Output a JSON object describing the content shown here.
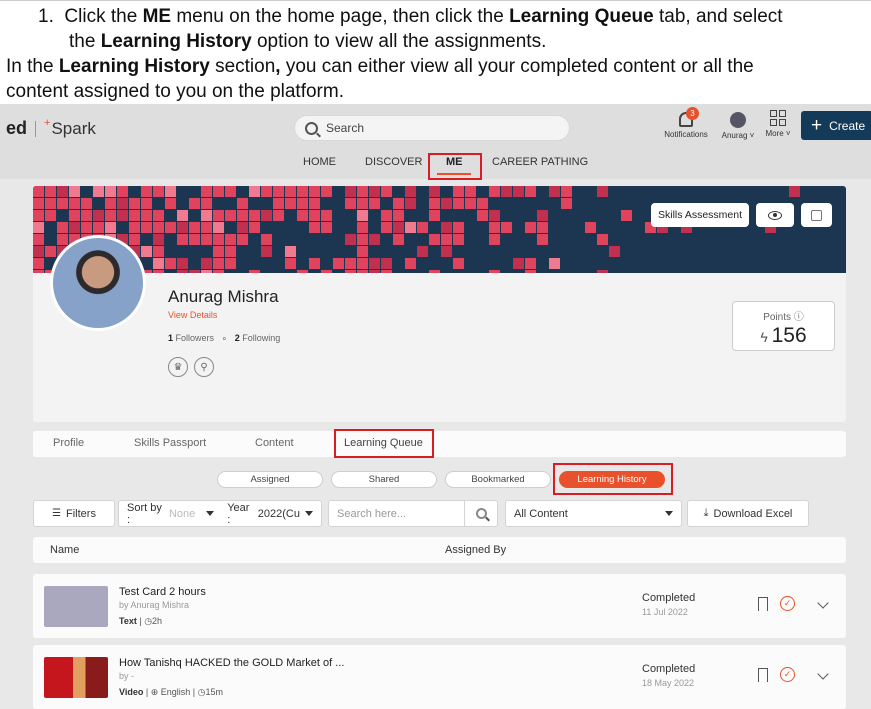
{
  "doc": {
    "line1_num": "1.",
    "line1_a": "Click the ",
    "line1_b": "ME",
    "line1_c": " menu on the home page, then click the ",
    "line1_d": "Learning Queue",
    "line1_e": " tab, and select",
    "line2_a": "the ",
    "line2_b": "Learning History",
    "line2_c": " option to view all the assignments.",
    "line3_a": "In the ",
    "line3_b": "Learning History",
    "line3_c": " section",
    "line3_d": ",",
    "line3_e": " you can either view all your completed content or all the",
    "line4": "content assigned to you on the platform."
  },
  "app": {
    "logo_ed": "ed",
    "logo_spark": "Spark",
    "search_placeholder": "Search",
    "notifications_label": "Notifications",
    "notifications_count": "3",
    "user_label": "Anurag ˅",
    "more_label": "More ˅",
    "create_label": "Create",
    "nav": [
      "HOME",
      "DISCOVER",
      "ME",
      "CAREER PATHING"
    ]
  },
  "profile": {
    "skills_btn": "Skills Assessment",
    "name": "Anurag Mishra",
    "view_details": "View Details",
    "followers_count": "1",
    "followers_label": "Followers",
    "following_count": "2",
    "following_label": "Following",
    "points_label": "Points ⓘ",
    "points_value": "156"
  },
  "tabs": [
    "Profile",
    "Skills Passport",
    "Content",
    "Learning Queue"
  ],
  "pills": [
    "Assigned",
    "Shared",
    "Bookmarked",
    "Learning History"
  ],
  "filters": {
    "filters_label": "Filters",
    "sortby_label": "Sort by :",
    "sortby_value": "None",
    "year_label": "Year :",
    "year_value": "2022(Cu",
    "search_placeholder": "Search here...",
    "content_value": "All Content",
    "download_label": "Download Excel"
  },
  "table": {
    "col_name": "Name",
    "col_assigned": "Assigned By"
  },
  "rows": [
    {
      "title": "Test Card 2 hours",
      "by": "by Anurag Mishra",
      "type": "Text",
      "duration": "2h",
      "lang": "",
      "status": "Completed",
      "date": "11 Jul 2022"
    },
    {
      "title": "How Tanishq HACKED the GOLD Market of ...",
      "by": "by -",
      "type": "Video",
      "lang": "English",
      "duration": "15m",
      "status": "Completed",
      "date": "18 May 2022"
    }
  ],
  "colors": {
    "accent": "#e8512b",
    "highlight_box": "#d81e24",
    "create_btn": "#143a5a"
  }
}
